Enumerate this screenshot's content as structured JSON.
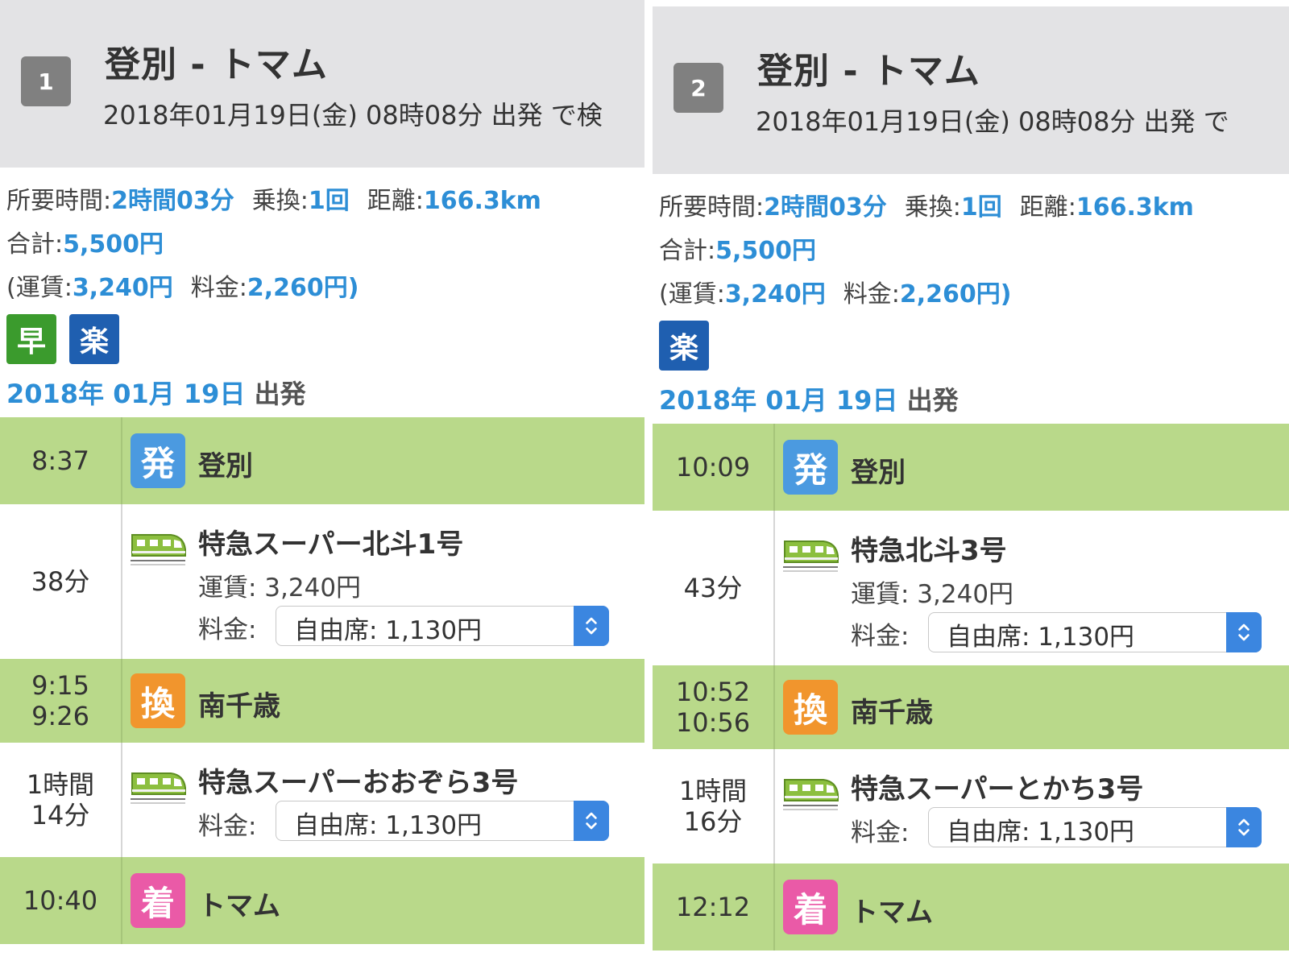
{
  "routes": [
    {
      "number": "1",
      "title": "登別 - トマム",
      "subtitle": "2018年01月19日(金) 08時08分 出発 で検",
      "summary": {
        "duration_label": "所要時間:",
        "duration_value": "2時間03分",
        "transfers_label": "乗換:",
        "transfers_value": "1回",
        "distance_label": "距離:",
        "distance_value": "166.3km",
        "total_label": "合計:",
        "total_value": "5,500円",
        "fare_open": "(運賃:",
        "fare_value": "3,240円",
        "fee_label": "料金:",
        "fee_value": "2,260円)"
      },
      "tags": [
        "早",
        "楽"
      ],
      "departure": {
        "year": "2018年",
        "month": "01月",
        "day": "19日",
        "suffix": "出発"
      },
      "legs": [
        {
          "type": "station",
          "times": [
            "8:37"
          ],
          "badge": "発",
          "name": "登別"
        },
        {
          "type": "ride",
          "times": [
            "38分"
          ],
          "train": "特急スーパー北斗1号",
          "fare": "運賃: 3,240円",
          "fee_label": "料金:",
          "fee_option": "自由席: 1,130円"
        },
        {
          "type": "station",
          "times": [
            "9:15",
            "9:26"
          ],
          "badge": "換",
          "name": "南千歳"
        },
        {
          "type": "ride",
          "times": [
            "1時間",
            "14分"
          ],
          "train": "特急スーパーおおぞら3号",
          "fee_label": "料金:",
          "fee_option": "自由席: 1,130円"
        },
        {
          "type": "station",
          "times": [
            "10:40"
          ],
          "badge": "着",
          "name": "トマム"
        }
      ]
    },
    {
      "number": "2",
      "title": "登別 - トマム",
      "subtitle": "2018年01月19日(金) 08時08分 出発 で",
      "summary": {
        "duration_label": "所要時間:",
        "duration_value": "2時間03分",
        "transfers_label": "乗換:",
        "transfers_value": "1回",
        "distance_label": "距離:",
        "distance_value": "166.3km",
        "total_label": "合計:",
        "total_value": "5,500円",
        "fare_open": "(運賃:",
        "fare_value": "3,240円",
        "fee_label": "料金:",
        "fee_value": "2,260円)"
      },
      "tags": [
        "楽"
      ],
      "departure": {
        "year": "2018年",
        "month": "01月",
        "day": "19日",
        "suffix": "出発"
      },
      "legs": [
        {
          "type": "station",
          "times": [
            "10:09"
          ],
          "badge": "発",
          "name": "登別"
        },
        {
          "type": "ride",
          "times": [
            "43分"
          ],
          "train": "特急北斗3号",
          "fare": "運賃: 3,240円",
          "fee_label": "料金:",
          "fee_option": "自由席: 1,130円"
        },
        {
          "type": "station",
          "times": [
            "10:52",
            "10:56"
          ],
          "badge": "換",
          "name": "南千歳"
        },
        {
          "type": "ride",
          "times": [
            "1時間",
            "16分"
          ],
          "train": "特急スーパーとかち3号",
          "fee_label": "料金:",
          "fee_option": "自由席: 1,130円"
        },
        {
          "type": "station",
          "times": [
            "12:12"
          ],
          "badge": "着",
          "name": "トマム"
        }
      ]
    }
  ],
  "colors": {
    "header_bg": "#e3e3e5",
    "station_row": "#b9d98a",
    "link_blue": "#2d8ed6",
    "badge_depart": "#4b9ae0",
    "badge_transfer": "#f1952d",
    "badge_arrive": "#ea5aa7",
    "tag_fast": "#3b9b2d",
    "tag_easy": "#1f5fb0",
    "stepper": "#3b86e0"
  },
  "icons": {
    "train": "train-icon",
    "stepper": "updown-chevron-icon"
  }
}
